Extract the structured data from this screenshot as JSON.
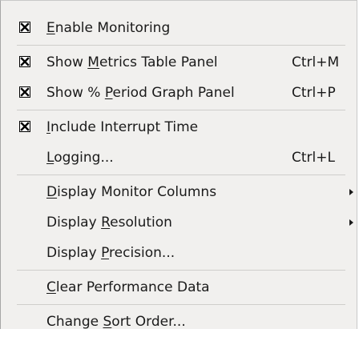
{
  "menu": {
    "items": [
      {
        "id": "enable-monitoring",
        "pre": "",
        "mn": "E",
        "post": "nable Monitoring",
        "shortcut": "",
        "checked": true
      },
      {
        "id": "show-metrics-table-panel",
        "pre": "Show ",
        "mn": "M",
        "post": "etrics Table Panel",
        "shortcut": "Ctrl+M",
        "checked": true
      },
      {
        "id": "show-period-graph-panel",
        "pre": "Show % ",
        "mn": "P",
        "post": "eriod Graph Panel",
        "shortcut": "Ctrl+P",
        "checked": true
      },
      {
        "id": "include-interrupt-time",
        "pre": "",
        "mn": "I",
        "post": "nclude Interrupt Time",
        "shortcut": "",
        "checked": true
      },
      {
        "id": "logging",
        "pre": "",
        "mn": "L",
        "post": "ogging...",
        "shortcut": "Ctrl+L",
        "checked": false
      },
      {
        "id": "display-monitor-columns",
        "pre": "",
        "mn": "D",
        "post": "isplay Monitor Columns",
        "shortcut": "",
        "checked": false,
        "submenu": true
      },
      {
        "id": "display-resolution",
        "pre": "Display ",
        "mn": "R",
        "post": "esolution",
        "shortcut": "",
        "checked": false,
        "submenu": true
      },
      {
        "id": "display-precision",
        "pre": "Display ",
        "mn": "P",
        "post": "recision...",
        "shortcut": "",
        "checked": false
      },
      {
        "id": "clear-performance-data",
        "pre": "",
        "mn": "C",
        "post": "lear Performance Data",
        "shortcut": "",
        "checked": false
      },
      {
        "id": "change-sort-order",
        "pre": "Change ",
        "mn": "S",
        "post": "ort Order...",
        "shortcut": "",
        "checked": false
      }
    ],
    "icons": {
      "check": "check-x-icon",
      "submenu": "submenu-arrow-icon"
    }
  }
}
